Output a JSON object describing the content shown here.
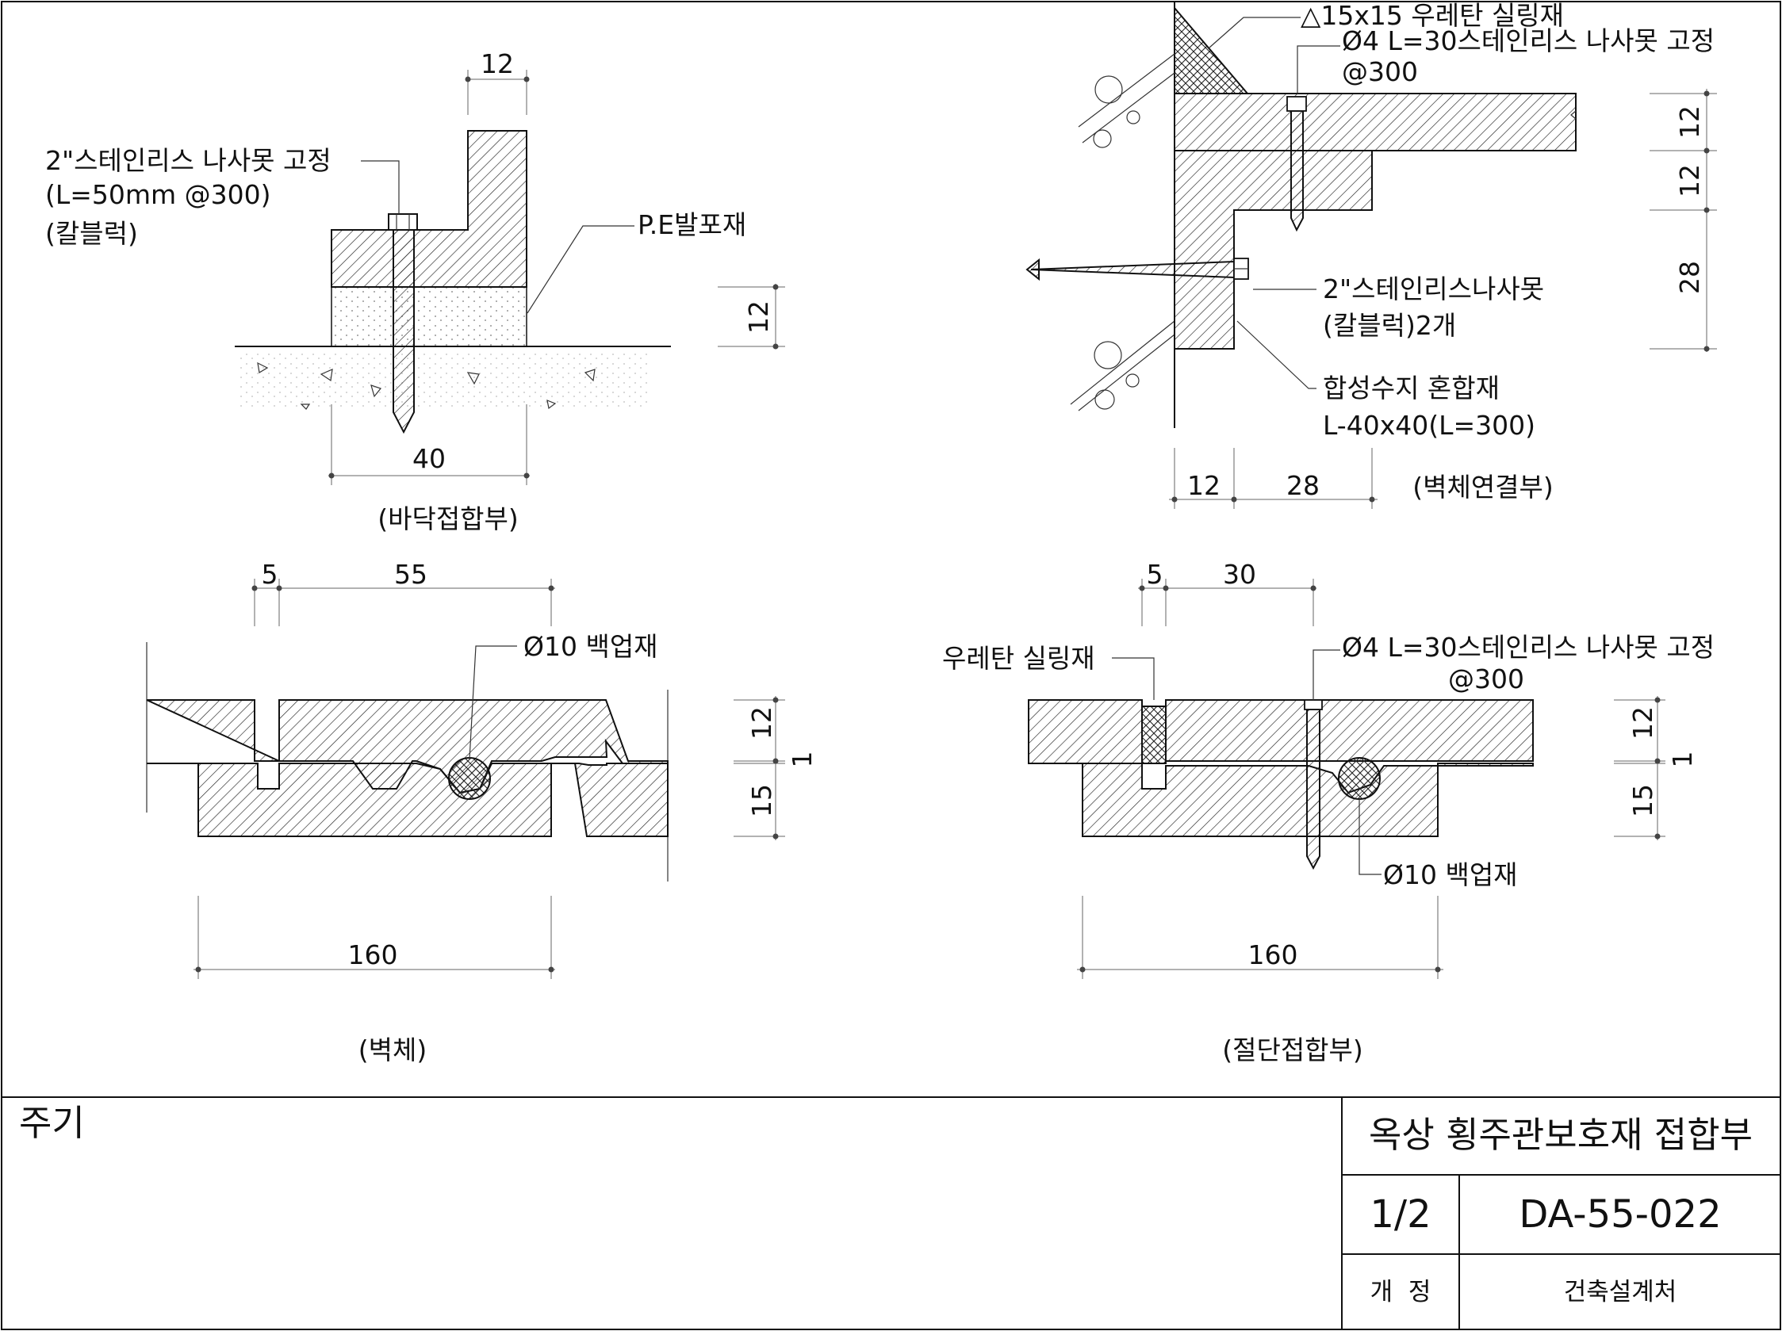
{
  "drawing": {
    "floor_joint": {
      "caption": "(바닥접합부)",
      "screw_label_line1": "2\"스테인리스 나사못 고정",
      "screw_label_line2": "(L=50mm @300)",
      "screw_label_line3": "(칼블럭)",
      "foam_label": "P.E발포재",
      "dim_top": "12",
      "dim_side": "12",
      "dim_bottom": "40"
    },
    "wall_joint": {
      "caption": "(벽체연결부)",
      "sealant_label": "△15x15 우레탄 실링재",
      "screw_label_line1": "Ø4 L=30스테인리스 나사못 고정",
      "screw_label_line2": "@300",
      "anchor_label_line1": "2\"스테인리스나사못",
      "anchor_label_line2": "(칼블럭)2개",
      "angle_label_line1": "합성수지 혼합재",
      "angle_label_line2": "L-40x40(L=300)",
      "dim_right_1": "12",
      "dim_right_2": "12",
      "dim_right_3": "28",
      "dim_bottom_1": "12",
      "dim_bottom_2": "28"
    },
    "wall_panel": {
      "caption": "(벽체)",
      "backup_label": "Ø10 백업재",
      "dim_top_1": "5",
      "dim_top_2": "55",
      "dim_side_1": "12",
      "dim_side_2": "1",
      "dim_side_3": "15",
      "dim_bottom": "160"
    },
    "cut_joint": {
      "caption": "(절단접합부)",
      "sealant_label": "우레탄 실링재",
      "screw_label_line1": "Ø4 L=30스테인리스 나사못 고정",
      "screw_label_line2": "@300",
      "backup_label": "Ø10 백업재",
      "dim_top_1": "5",
      "dim_top_2": "30",
      "dim_side_1": "12",
      "dim_side_2": "1",
      "dim_side_3": "15",
      "dim_bottom": "160"
    }
  },
  "title_block": {
    "notes_label": "주기",
    "drawing_title": "옥상 횡주관보호재 접합부",
    "sheet_number": "1/2",
    "drawing_code": "DA-55-022",
    "revision_label": "개  정",
    "department": "건축설계처"
  }
}
